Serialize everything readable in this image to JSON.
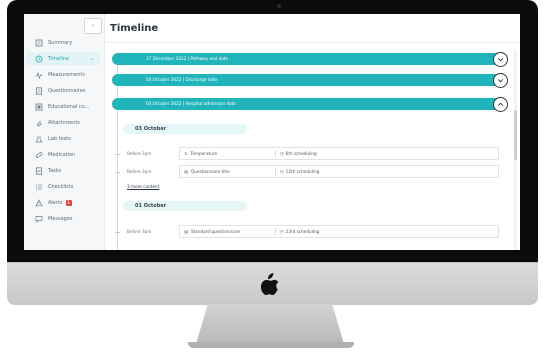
{
  "app": {
    "page_title": "Timeline",
    "collapse_label": "«"
  },
  "sidebar": {
    "items": [
      {
        "label": "Summary",
        "icon": "summary-icon"
      },
      {
        "label": "Timeline",
        "icon": "timeline-icon",
        "active": true
      },
      {
        "label": "Measurements",
        "icon": "measurements-icon"
      },
      {
        "label": "Questionnaires",
        "icon": "questionnaire-icon"
      },
      {
        "label": "Educational co...",
        "icon": "education-icon"
      },
      {
        "label": "Attachments",
        "icon": "attachment-icon"
      },
      {
        "label": "Lab tests",
        "icon": "lab-icon"
      },
      {
        "label": "Medication",
        "icon": "pill-icon"
      },
      {
        "label": "Tasks",
        "icon": "tasks-icon"
      },
      {
        "label": "Checklists",
        "icon": "checklist-icon"
      },
      {
        "label": "Alerts",
        "icon": "alert-icon",
        "badge": "1"
      },
      {
        "label": "Messages",
        "icon": "messages-icon"
      }
    ]
  },
  "timeline": {
    "events": [
      {
        "label": "17 December 2022  |  Pathway end date",
        "expanded": false
      },
      {
        "label": "04 October 2022  |  Discharge date",
        "expanded": false
      },
      {
        "label": "03 October 2022  |  Hospital admission date",
        "expanded": true
      }
    ],
    "groups": [
      {
        "date": "03 October",
        "rows": [
          {
            "time": "Before 3pm",
            "name": "Temperature",
            "schedule": "6th scheduling"
          },
          {
            "time": "Before 3pm",
            "name": "Questionnaire title",
            "schedule": "12th scheduling"
          }
        ],
        "more": "3 more content"
      },
      {
        "date": "01 October",
        "rows": [
          {
            "time": "Before 3pm",
            "name": "Standard questionnaire",
            "schedule": "23rd scheduling"
          }
        ]
      }
    ]
  },
  "colors": {
    "accent": "#1fb5ba",
    "accent_light": "#e4f6f6",
    "alert": "#e54848"
  }
}
